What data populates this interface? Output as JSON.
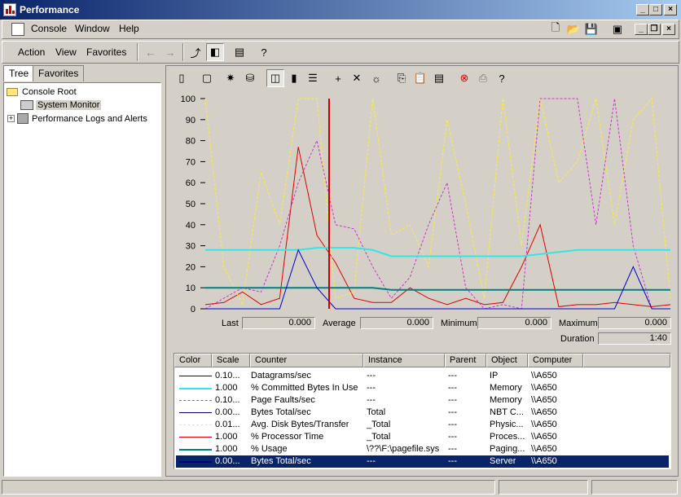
{
  "window": {
    "title": "Performance"
  },
  "menubar": [
    "Console",
    "Window",
    "Help"
  ],
  "actionbar": [
    "Action",
    "View",
    "Favorites"
  ],
  "tabs": [
    "Tree",
    "Favorites"
  ],
  "tree": {
    "root": "Console Root",
    "items": [
      "System Monitor",
      "Performance Logs and Alerts"
    ]
  },
  "graph": {
    "y_ticks": [
      "100",
      "90",
      "80",
      "70",
      "60",
      "50",
      "40",
      "30",
      "20",
      "10",
      "0"
    ]
  },
  "stats": {
    "last_label": "Last",
    "last": "0.000",
    "average_label": "Average",
    "average": "0.000",
    "minimum_label": "Minimum",
    "minimum": "0.000",
    "maximum_label": "Maximum",
    "maximum": "0.000",
    "duration_label": "Duration",
    "duration": "1:40"
  },
  "legend": {
    "headers": [
      "Color",
      "Scale",
      "Counter",
      "Instance",
      "Parent",
      "Object",
      "Computer"
    ],
    "rows": [
      {
        "color": "#0000cc",
        "style": "solid",
        "width": 1,
        "scale": "0.10...",
        "counter": "Datagrams/sec",
        "instance": "---",
        "parent": "---",
        "object": "IP",
        "computer": "\\\\A650"
      },
      {
        "color": "#33e6e6",
        "style": "solid",
        "width": 2,
        "scale": "1.000",
        "counter": "% Committed Bytes In Use",
        "instance": "---",
        "parent": "---",
        "object": "Memory",
        "computer": "\\\\A650"
      },
      {
        "color": "#cc33cc",
        "style": "dashed",
        "width": 1,
        "scale": "0.10...",
        "counter": "Page Faults/sec",
        "instance": "---",
        "parent": "---",
        "object": "Memory",
        "computer": "\\\\A650"
      },
      {
        "color": "#000080",
        "style": "solid",
        "width": 1,
        "scale": "0.00...",
        "counter": "Bytes Total/sec",
        "instance": "Total",
        "parent": "---",
        "object": "NBT C...",
        "computer": "\\\\A650"
      },
      {
        "color": "#ffee33",
        "style": "dashed",
        "width": 1,
        "scale": "0.01...",
        "counter": "Avg. Disk Bytes/Transfer",
        "instance": "_Total",
        "parent": "---",
        "object": "Physic...",
        "computer": "\\\\A650"
      },
      {
        "color": "#dd0000",
        "style": "solid",
        "width": 1,
        "scale": "1.000",
        "counter": "% Processor Time",
        "instance": "_Total",
        "parent": "---",
        "object": "Proces...",
        "computer": "\\\\A650"
      },
      {
        "color": "#008080",
        "style": "solid",
        "width": 2,
        "scale": "1.000",
        "counter": "% Usage",
        "instance": "\\??\\F:\\pagefile.sys",
        "parent": "---",
        "object": "Paging...",
        "computer": "\\\\A650"
      },
      {
        "color": "#000080",
        "style": "solid",
        "width": 2,
        "scale": "0.00...",
        "counter": "Bytes Total/sec",
        "instance": "---",
        "parent": "---",
        "object": "Server",
        "computer": "\\\\A650",
        "selected": true
      }
    ]
  },
  "chart_data": {
    "type": "line",
    "ylim": [
      0,
      100
    ],
    "x": [
      0,
      4,
      8,
      12,
      16,
      20,
      24,
      28,
      32,
      36,
      40,
      44,
      48,
      52,
      56,
      60,
      64,
      68,
      72,
      76,
      80,
      84,
      88,
      92,
      96,
      100
    ],
    "series": [
      {
        "color": "#dd0000",
        "values": [
          2,
          3,
          8,
          2,
          5,
          77,
          35,
          22,
          5,
          3,
          3,
          10,
          5,
          2,
          5,
          2,
          3,
          20,
          40,
          1,
          2,
          2,
          3,
          2,
          1,
          2
        ]
      },
      {
        "color": "#ffee33",
        "values": [
          100,
          20,
          2,
          65,
          40,
          100,
          100,
          5,
          8,
          100,
          35,
          40,
          20,
          90,
          50,
          5,
          100,
          30,
          100,
          60,
          70,
          100,
          40,
          90,
          100,
          5
        ]
      },
      {
        "color": "#cc33cc",
        "values": [
          0,
          5,
          10,
          8,
          30,
          60,
          80,
          40,
          38,
          20,
          5,
          15,
          40,
          60,
          10,
          0,
          2,
          0,
          100,
          100,
          100,
          40,
          100,
          30,
          0,
          0
        ]
      },
      {
        "color": "#33e6e6",
        "values": [
          28,
          28,
          28,
          28,
          28,
          28,
          29,
          29,
          29,
          28,
          25,
          25,
          25,
          25,
          25,
          25,
          25,
          25,
          26,
          27,
          28,
          28,
          28,
          28,
          28,
          28
        ]
      },
      {
        "color": "#008080",
        "values": [
          10,
          10,
          10,
          10,
          10,
          10,
          10,
          10,
          10,
          10,
          9,
          9,
          9,
          9,
          9,
          9,
          9,
          9,
          9,
          9,
          9,
          9,
          9,
          9,
          9,
          9
        ]
      },
      {
        "color": "#0000cc",
        "values": [
          0,
          0,
          0,
          0,
          0,
          28,
          10,
          0,
          0,
          0,
          0,
          0,
          0,
          0,
          0,
          0,
          0,
          0,
          0,
          0,
          0,
          0,
          0,
          20,
          0,
          0
        ]
      }
    ]
  }
}
